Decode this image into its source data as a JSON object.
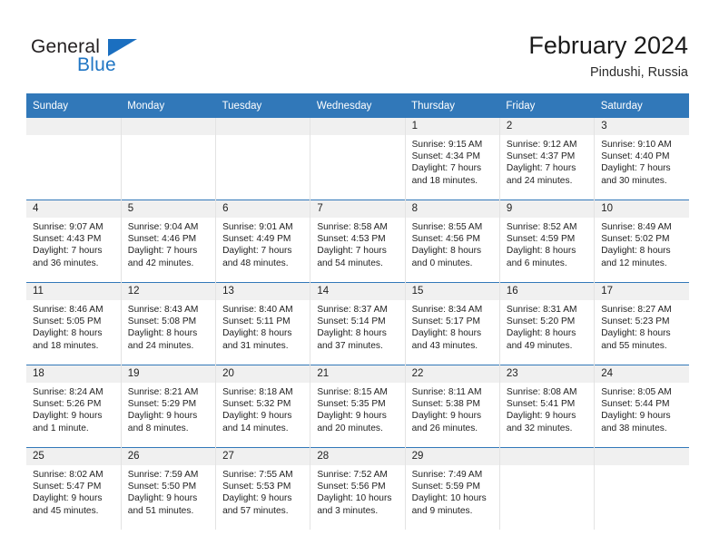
{
  "brand": {
    "name_part1": "General",
    "name_part2": "Blue",
    "flag_icon": "triangle-flag-icon"
  },
  "header": {
    "title": "February 2024",
    "location": "Pindushi, Russia"
  },
  "colors": {
    "header_blue": "#3178b9",
    "brand_blue": "#2076c4",
    "daystrip_gray": "#f0f0f0",
    "text": "#1f1f1f"
  },
  "calendar": {
    "weekday_headers": [
      "Sunday",
      "Monday",
      "Tuesday",
      "Wednesday",
      "Thursday",
      "Friday",
      "Saturday"
    ],
    "weeks": [
      [
        {
          "day": "",
          "sunrise": "",
          "sunset": "",
          "daylight_line1": "",
          "daylight_line2": ""
        },
        {
          "day": "",
          "sunrise": "",
          "sunset": "",
          "daylight_line1": "",
          "daylight_line2": ""
        },
        {
          "day": "",
          "sunrise": "",
          "sunset": "",
          "daylight_line1": "",
          "daylight_line2": ""
        },
        {
          "day": "",
          "sunrise": "",
          "sunset": "",
          "daylight_line1": "",
          "daylight_line2": ""
        },
        {
          "day": "1",
          "sunrise": "Sunrise: 9:15 AM",
          "sunset": "Sunset: 4:34 PM",
          "daylight_line1": "Daylight: 7 hours",
          "daylight_line2": "and 18 minutes."
        },
        {
          "day": "2",
          "sunrise": "Sunrise: 9:12 AM",
          "sunset": "Sunset: 4:37 PM",
          "daylight_line1": "Daylight: 7 hours",
          "daylight_line2": "and 24 minutes."
        },
        {
          "day": "3",
          "sunrise": "Sunrise: 9:10 AM",
          "sunset": "Sunset: 4:40 PM",
          "daylight_line1": "Daylight: 7 hours",
          "daylight_line2": "and 30 minutes."
        }
      ],
      [
        {
          "day": "4",
          "sunrise": "Sunrise: 9:07 AM",
          "sunset": "Sunset: 4:43 PM",
          "daylight_line1": "Daylight: 7 hours",
          "daylight_line2": "and 36 minutes."
        },
        {
          "day": "5",
          "sunrise": "Sunrise: 9:04 AM",
          "sunset": "Sunset: 4:46 PM",
          "daylight_line1": "Daylight: 7 hours",
          "daylight_line2": "and 42 minutes."
        },
        {
          "day": "6",
          "sunrise": "Sunrise: 9:01 AM",
          "sunset": "Sunset: 4:49 PM",
          "daylight_line1": "Daylight: 7 hours",
          "daylight_line2": "and 48 minutes."
        },
        {
          "day": "7",
          "sunrise": "Sunrise: 8:58 AM",
          "sunset": "Sunset: 4:53 PM",
          "daylight_line1": "Daylight: 7 hours",
          "daylight_line2": "and 54 minutes."
        },
        {
          "day": "8",
          "sunrise": "Sunrise: 8:55 AM",
          "sunset": "Sunset: 4:56 PM",
          "daylight_line1": "Daylight: 8 hours",
          "daylight_line2": "and 0 minutes."
        },
        {
          "day": "9",
          "sunrise": "Sunrise: 8:52 AM",
          "sunset": "Sunset: 4:59 PM",
          "daylight_line1": "Daylight: 8 hours",
          "daylight_line2": "and 6 minutes."
        },
        {
          "day": "10",
          "sunrise": "Sunrise: 8:49 AM",
          "sunset": "Sunset: 5:02 PM",
          "daylight_line1": "Daylight: 8 hours",
          "daylight_line2": "and 12 minutes."
        }
      ],
      [
        {
          "day": "11",
          "sunrise": "Sunrise: 8:46 AM",
          "sunset": "Sunset: 5:05 PM",
          "daylight_line1": "Daylight: 8 hours",
          "daylight_line2": "and 18 minutes."
        },
        {
          "day": "12",
          "sunrise": "Sunrise: 8:43 AM",
          "sunset": "Sunset: 5:08 PM",
          "daylight_line1": "Daylight: 8 hours",
          "daylight_line2": "and 24 minutes."
        },
        {
          "day": "13",
          "sunrise": "Sunrise: 8:40 AM",
          "sunset": "Sunset: 5:11 PM",
          "daylight_line1": "Daylight: 8 hours",
          "daylight_line2": "and 31 minutes."
        },
        {
          "day": "14",
          "sunrise": "Sunrise: 8:37 AM",
          "sunset": "Sunset: 5:14 PM",
          "daylight_line1": "Daylight: 8 hours",
          "daylight_line2": "and 37 minutes."
        },
        {
          "day": "15",
          "sunrise": "Sunrise: 8:34 AM",
          "sunset": "Sunset: 5:17 PM",
          "daylight_line1": "Daylight: 8 hours",
          "daylight_line2": "and 43 minutes."
        },
        {
          "day": "16",
          "sunrise": "Sunrise: 8:31 AM",
          "sunset": "Sunset: 5:20 PM",
          "daylight_line1": "Daylight: 8 hours",
          "daylight_line2": "and 49 minutes."
        },
        {
          "day": "17",
          "sunrise": "Sunrise: 8:27 AM",
          "sunset": "Sunset: 5:23 PM",
          "daylight_line1": "Daylight: 8 hours",
          "daylight_line2": "and 55 minutes."
        }
      ],
      [
        {
          "day": "18",
          "sunrise": "Sunrise: 8:24 AM",
          "sunset": "Sunset: 5:26 PM",
          "daylight_line1": "Daylight: 9 hours",
          "daylight_line2": "and 1 minute."
        },
        {
          "day": "19",
          "sunrise": "Sunrise: 8:21 AM",
          "sunset": "Sunset: 5:29 PM",
          "daylight_line1": "Daylight: 9 hours",
          "daylight_line2": "and 8 minutes."
        },
        {
          "day": "20",
          "sunrise": "Sunrise: 8:18 AM",
          "sunset": "Sunset: 5:32 PM",
          "daylight_line1": "Daylight: 9 hours",
          "daylight_line2": "and 14 minutes."
        },
        {
          "day": "21",
          "sunrise": "Sunrise: 8:15 AM",
          "sunset": "Sunset: 5:35 PM",
          "daylight_line1": "Daylight: 9 hours",
          "daylight_line2": "and 20 minutes."
        },
        {
          "day": "22",
          "sunrise": "Sunrise: 8:11 AM",
          "sunset": "Sunset: 5:38 PM",
          "daylight_line1": "Daylight: 9 hours",
          "daylight_line2": "and 26 minutes."
        },
        {
          "day": "23",
          "sunrise": "Sunrise: 8:08 AM",
          "sunset": "Sunset: 5:41 PM",
          "daylight_line1": "Daylight: 9 hours",
          "daylight_line2": "and 32 minutes."
        },
        {
          "day": "24",
          "sunrise": "Sunrise: 8:05 AM",
          "sunset": "Sunset: 5:44 PM",
          "daylight_line1": "Daylight: 9 hours",
          "daylight_line2": "and 38 minutes."
        }
      ],
      [
        {
          "day": "25",
          "sunrise": "Sunrise: 8:02 AM",
          "sunset": "Sunset: 5:47 PM",
          "daylight_line1": "Daylight: 9 hours",
          "daylight_line2": "and 45 minutes."
        },
        {
          "day": "26",
          "sunrise": "Sunrise: 7:59 AM",
          "sunset": "Sunset: 5:50 PM",
          "daylight_line1": "Daylight: 9 hours",
          "daylight_line2": "and 51 minutes."
        },
        {
          "day": "27",
          "sunrise": "Sunrise: 7:55 AM",
          "sunset": "Sunset: 5:53 PM",
          "daylight_line1": "Daylight: 9 hours",
          "daylight_line2": "and 57 minutes."
        },
        {
          "day": "28",
          "sunrise": "Sunrise: 7:52 AM",
          "sunset": "Sunset: 5:56 PM",
          "daylight_line1": "Daylight: 10 hours",
          "daylight_line2": "and 3 minutes."
        },
        {
          "day": "29",
          "sunrise": "Sunrise: 7:49 AM",
          "sunset": "Sunset: 5:59 PM",
          "daylight_line1": "Daylight: 10 hours",
          "daylight_line2": "and 9 minutes."
        },
        {
          "day": "",
          "sunrise": "",
          "sunset": "",
          "daylight_line1": "",
          "daylight_line2": ""
        },
        {
          "day": "",
          "sunrise": "",
          "sunset": "",
          "daylight_line1": "",
          "daylight_line2": ""
        }
      ]
    ]
  }
}
